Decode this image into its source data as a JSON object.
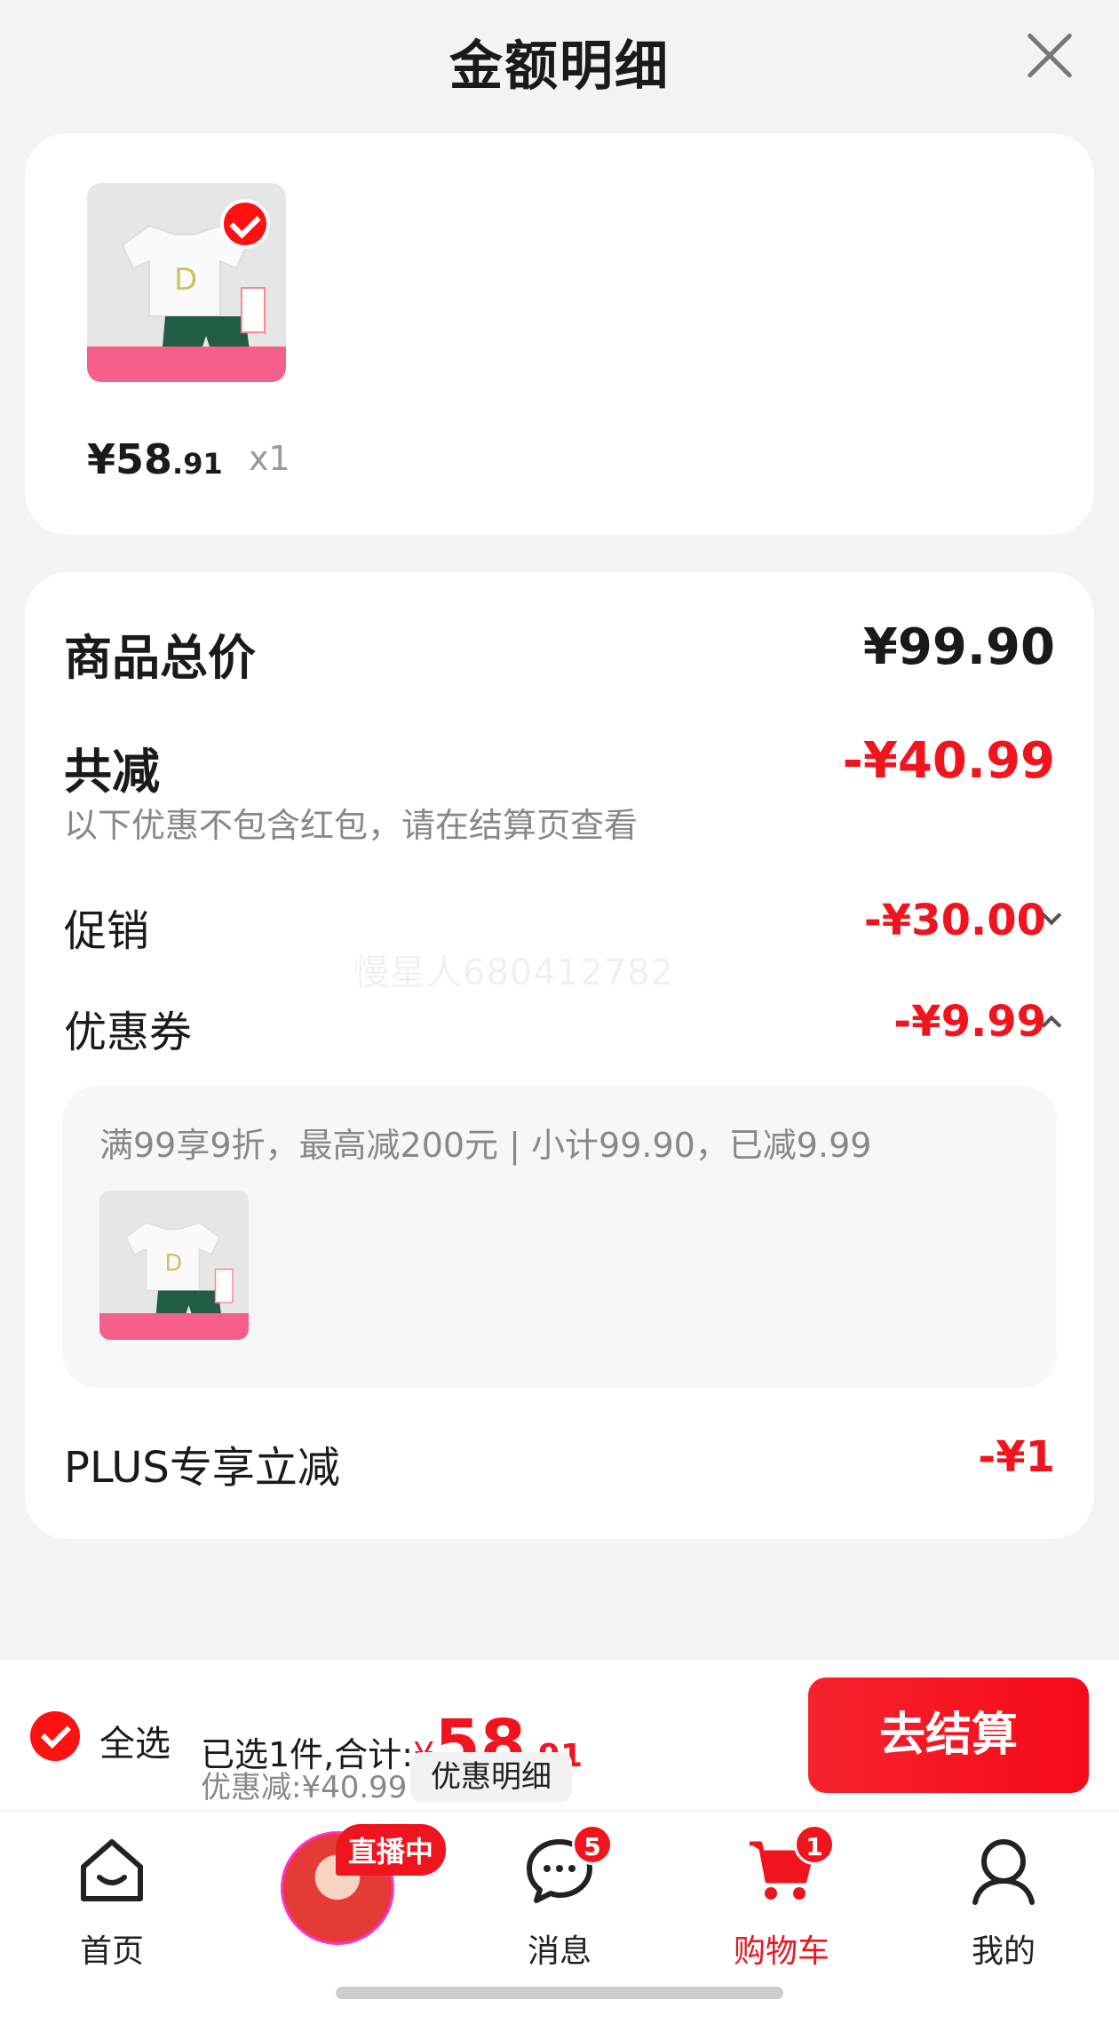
{
  "header": {
    "title": "金额明细"
  },
  "product": {
    "price_main": "¥58",
    "price_dec": ".91",
    "qty": "x1"
  },
  "summary": {
    "total_label": "商品总价",
    "total_value": "¥99.90",
    "reduce_label": "共减",
    "reduce_value": "-¥40.99",
    "note": "以下优惠不包含红包，请在结算页查看",
    "promo_label": "促销",
    "promo_value": "-¥30.00",
    "coupon_label": "优惠券",
    "coupon_value": "-¥9.99",
    "coupon_desc": "满99享9折，最高减200元 | 小计99.90，已减9.99",
    "plus_label": "PLUS专享立减",
    "plus_value": "-¥1"
  },
  "watermark": "慢星人680412782",
  "checkout": {
    "select_all": "全选",
    "selected_text": "已选1件,合计:",
    "total_yen": "¥",
    "total_big": "58",
    "total_dec": ".91",
    "discount_text": "优惠减:¥40.99",
    "discount_detail": "优惠明细",
    "checkout_button": "去结算"
  },
  "tabbar": {
    "home": "首页",
    "live_badge": "直播中",
    "messages": "消息",
    "messages_count": "5",
    "cart": "购物车",
    "cart_count": "1",
    "me": "我的"
  },
  "colors": {
    "accent": "#f0141e",
    "background": "#f3f3f3",
    "card": "#ffffff"
  }
}
